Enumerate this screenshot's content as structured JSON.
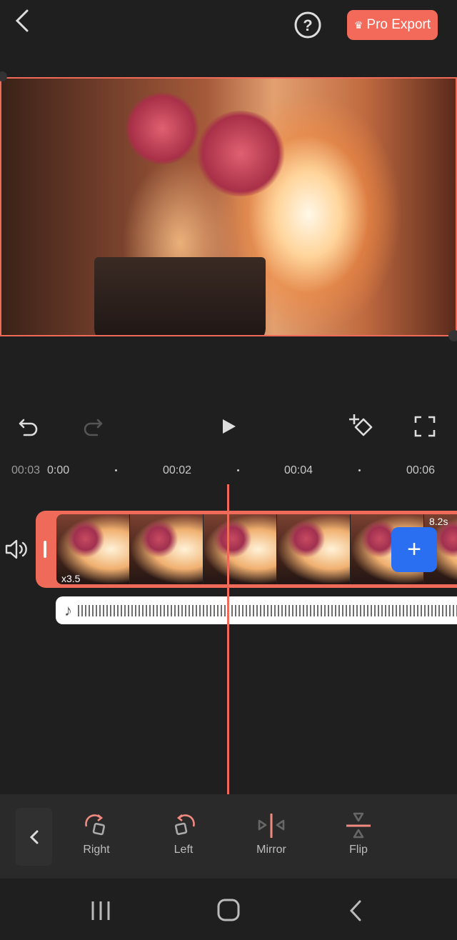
{
  "header": {
    "pro_export_label": "Pro Export",
    "icons": [
      "back-arrow-icon",
      "help-icon",
      "crown-icon"
    ]
  },
  "controls": {
    "icons": [
      "undo-icon",
      "redo-icon",
      "play-icon",
      "add-keyframe-icon",
      "fullscreen-icon"
    ]
  },
  "ruler": {
    "current_time": "00:03",
    "ticks": [
      "0:00",
      "00:02",
      "00:04",
      "00:06"
    ]
  },
  "clip": {
    "speed_label": "x3.5",
    "duration_label": "8.2s"
  },
  "colors": {
    "accent": "#f06a5a",
    "add_button": "#2a6ef2",
    "background": "#1f1f1f"
  },
  "toolbar": {
    "items": [
      {
        "label": "Right",
        "icon": "rotate-right-icon"
      },
      {
        "label": "Left",
        "icon": "rotate-left-icon"
      },
      {
        "label": "Mirror",
        "icon": "mirror-icon"
      },
      {
        "label": "Flip",
        "icon": "flip-icon"
      }
    ]
  }
}
